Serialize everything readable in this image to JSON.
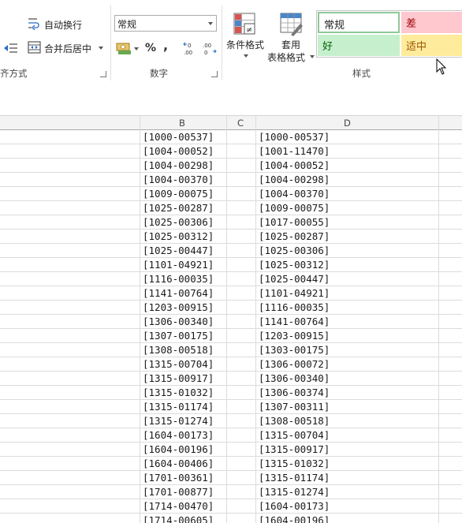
{
  "ribbon": {
    "alignment": {
      "wrap_text": "自动换行",
      "merge_center": "合并后居中",
      "group_label": "齐方式"
    },
    "number": {
      "format_value": "常规",
      "percent": "%",
      "comma": ",",
      "group_label": "数字"
    },
    "styles_buttons": {
      "conditional_format": "条件格式",
      "table_format_line1": "套用",
      "table_format_line2": "表格格式"
    },
    "styles": {
      "normal": "常规",
      "bad": "差",
      "good": "好",
      "neutral": "适中",
      "group_label": "样式",
      "colors": {
        "normal_bg": "#ffffff",
        "normal_border": "#8fc89a",
        "bad_bg": "#ffc7ce",
        "bad_text": "#9c0006",
        "good_bg": "#c6efce",
        "good_text": "#006100",
        "neutral_bg": "#ffeb9c",
        "neutral_text": "#9c5700"
      }
    }
  },
  "columns": [
    "B",
    "C",
    "D"
  ],
  "rows": [
    {
      "b": "[1000-00537]",
      "d": "[1000-00537]"
    },
    {
      "b": "[1004-00052]",
      "d": "[1001-11470]"
    },
    {
      "b": "[1004-00298]",
      "d": "[1004-00052]"
    },
    {
      "b": "[1004-00370]",
      "d": "[1004-00298]"
    },
    {
      "b": "[1009-00075]",
      "d": "[1004-00370]"
    },
    {
      "b": "[1025-00287]",
      "d": "[1009-00075]"
    },
    {
      "b": "[1025-00306]",
      "d": "[1017-00055]"
    },
    {
      "b": "[1025-00312]",
      "d": "[1025-00287]"
    },
    {
      "b": "[1025-00447]",
      "d": "[1025-00306]"
    },
    {
      "b": "[1101-04921]",
      "d": "[1025-00312]"
    },
    {
      "b": "[1116-00035]",
      "d": "[1025-00447]"
    },
    {
      "b": "[1141-00764]",
      "d": "[1101-04921]"
    },
    {
      "b": "[1203-00915]",
      "d": "[1116-00035]"
    },
    {
      "b": "[1306-00340]",
      "d": "[1141-00764]"
    },
    {
      "b": "[1307-00175]",
      "d": "[1203-00915]"
    },
    {
      "b": "[1308-00518]",
      "d": "[1303-00175]"
    },
    {
      "b": "[1315-00704]",
      "d": "[1306-00072]"
    },
    {
      "b": "[1315-00917]",
      "d": "[1306-00340]"
    },
    {
      "b": "[1315-01032]",
      "d": "[1306-00374]"
    },
    {
      "b": "[1315-01174]",
      "d": "[1307-00311]"
    },
    {
      "b": "[1315-01274]",
      "d": "[1308-00518]"
    },
    {
      "b": "[1604-00173]",
      "d": "[1315-00704]"
    },
    {
      "b": "[1604-00196]",
      "d": "[1315-00917]"
    },
    {
      "b": "[1604-00406]",
      "d": "[1315-01032]"
    },
    {
      "b": "[1701-00361]",
      "d": "[1315-01174]"
    },
    {
      "b": "[1701-00877]",
      "d": "[1315-01274]"
    },
    {
      "b": "[1714-00470]",
      "d": "[1604-00173]"
    },
    {
      "b": "[1714-00605]",
      "d": "[1604-00196]"
    }
  ]
}
